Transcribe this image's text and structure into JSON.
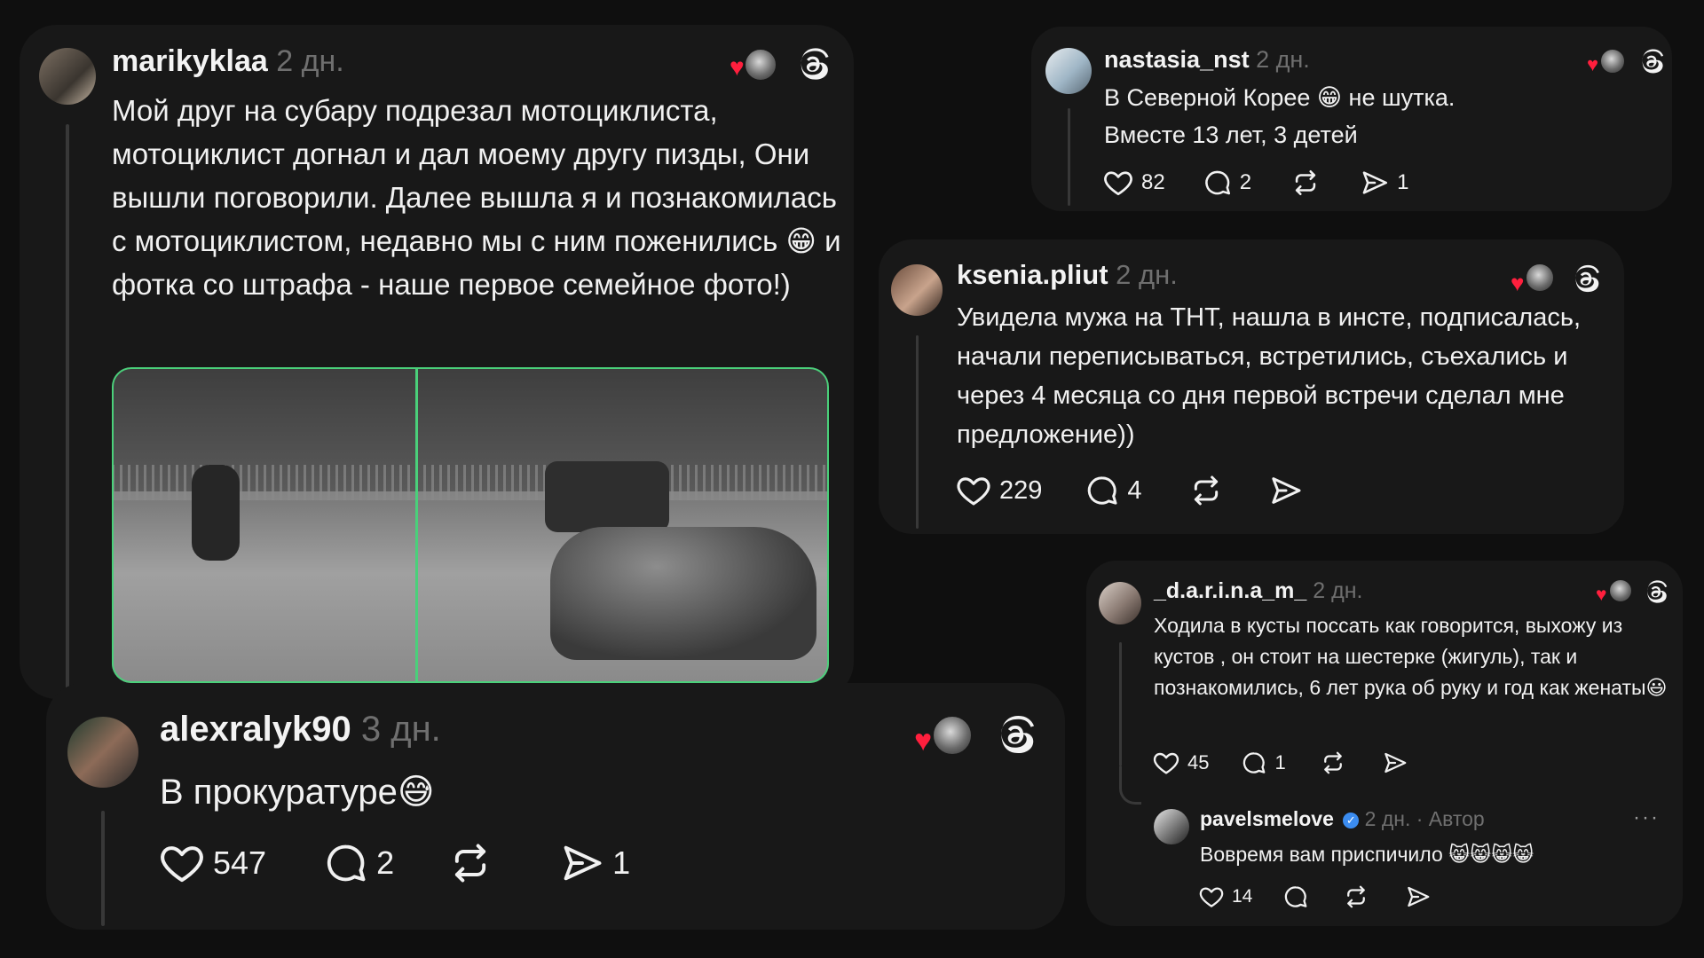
{
  "posts": {
    "p1": {
      "username": "marikyklaa",
      "time": "2 дн.",
      "text": "Мой друг на субару подрезал мотоциклиста, мотоциклист догнал и дал моему другу пизды, Они вышли поговорили. Далее вышла я и познакомилась с мотоциклистом, недавно мы с ним поженились 😁 и фотка со штрафа - наше первое семейное фото!)",
      "image_alt": "traffic camera photo: motorcycle and sports car"
    },
    "p2": {
      "username": "alexralyk90",
      "time": "3 дн.",
      "text": "В прокуратуре😅",
      "likes": "547",
      "comments": "2",
      "shares": "1"
    },
    "p3": {
      "username": "nastasia_nst",
      "time": "2 дн.",
      "text_line1": "В Северной Корее 😁 не шутка.",
      "text_line2": "Вместе 13 лет, 3 детей",
      "likes": "82",
      "comments": "2",
      "shares": "1"
    },
    "p4": {
      "username": "ksenia.pliut",
      "time": "2 дн.",
      "text": "Увидела мужа на ТНТ, нашла в инсте, подписалась, начали переписываться, встретились, съехались и через 4 месяца со дня первой встречи сделал мне предложение))",
      "likes": "229",
      "comments": "4"
    },
    "p5": {
      "username": "_d.a.r.i.n.a_m_",
      "time": "2 дн.",
      "text": "Ходила в кусты поссать как говорится, выхожу из кустов , он стоит на шестерке (жигуль), так и познакомились, 6 лет рука об руку и год как женаты😃",
      "likes": "45",
      "comments": "1"
    },
    "p5_reply": {
      "username": "pavelsmelove",
      "verified_mark": "✓",
      "time": "2 дн. · Автор",
      "text": "Вовремя вам приспичило 😸😸😸😸",
      "likes": "14",
      "more": "···"
    }
  },
  "colors": {
    "background": "#0f0f0f",
    "card": "#181818",
    "heart_red": "#ff1f3d",
    "muted": "#6f6f6f"
  },
  "icons": [
    "heart-icon",
    "comment-icon",
    "repost-icon",
    "share-icon",
    "threads-logo-icon",
    "liked-by-heart-icon"
  ]
}
